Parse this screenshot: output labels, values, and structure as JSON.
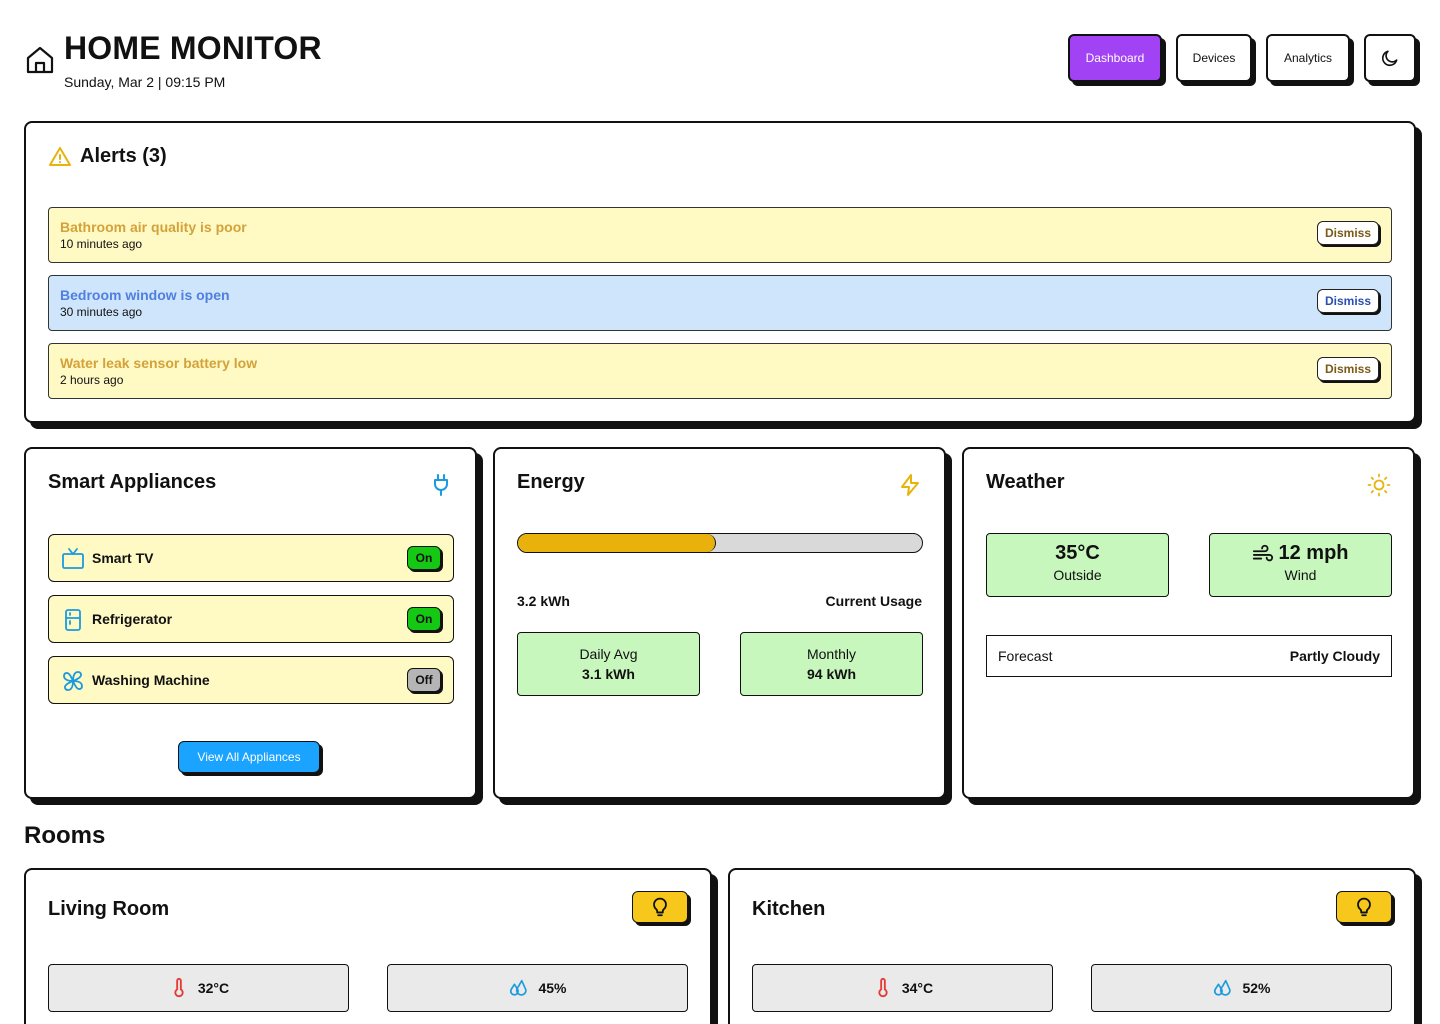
{
  "header": {
    "title": "HOME MONITOR",
    "subtitle": "Sunday, Mar 2 | 09:15 PM",
    "home_icon": "home-icon",
    "nav": {
      "dashboard": "Dashboard",
      "devices": "Devices",
      "analytics": "Analytics",
      "theme_icon": "moon-icon"
    },
    "accent": "#a142f4"
  },
  "alerts": {
    "title": "Alerts (3)",
    "icon": "warning-icon",
    "items": [
      {
        "message": "Bathroom air quality is poor",
        "time": "10 minutes ago",
        "dismiss": "Dismiss",
        "color": "#fff9c4"
      },
      {
        "message": "Bedroom window is open",
        "time": "30 minutes ago",
        "dismiss": "Dismiss",
        "color": "#cfe5fb"
      },
      {
        "message": "Water leak sensor battery low",
        "time": "2 hours ago",
        "dismiss": "Dismiss",
        "color": "#fff9c4"
      }
    ]
  },
  "appliances": {
    "title": "Smart Appliances",
    "icon": "plug-icon",
    "items": [
      {
        "name": "Smart TV",
        "state": "On",
        "icon": "tv-icon"
      },
      {
        "name": "Refrigerator",
        "state": "On",
        "icon": "fridge-icon"
      },
      {
        "name": "Washing Machine",
        "state": "Off",
        "icon": "fan-icon"
      }
    ],
    "view_all": "View All Appliances"
  },
  "energy": {
    "title": "Energy",
    "icon": "lightning-icon",
    "usage_fraction": 0.49,
    "usage_value": "3.2 kWh",
    "usage_label": "Current Usage",
    "daily_label": "Daily Avg",
    "daily_value": "3.1 kWh",
    "monthly_label": "Monthly",
    "monthly_value": "94 kWh"
  },
  "weather": {
    "title": "Weather",
    "icon": "sun-icon",
    "temp": "35°C",
    "temp_label": "Outside",
    "wind": "12 mph",
    "wind_label": "Wind",
    "wind_icon": "wind-icon",
    "forecast_label": "Forecast",
    "forecast_value": "Partly Cloudy"
  },
  "rooms": {
    "title": "Rooms",
    "items": [
      {
        "name": "Living Room",
        "temp": "32°C",
        "humidity": "45%",
        "light_icon": "bulb-icon"
      },
      {
        "name": "Kitchen",
        "temp": "34°C",
        "humidity": "52%",
        "light_icon": "bulb-icon"
      }
    ]
  }
}
